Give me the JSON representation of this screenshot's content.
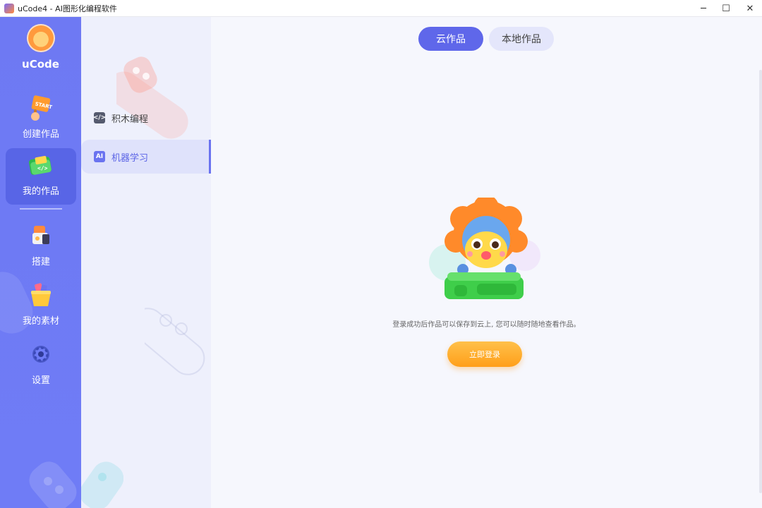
{
  "window": {
    "title": "uCode4 - AI图形化编程软件",
    "minimize_label": "─",
    "maximize_label": "☐",
    "close_label": "✕"
  },
  "nav": {
    "brand": "uCode",
    "items": [
      {
        "label": "创建作品",
        "icon": "start-flag-icon",
        "color": "#ffb23a"
      },
      {
        "label": "我的作品",
        "icon": "folder-code-icon",
        "color": "#4cd163"
      },
      {
        "label": "搭建",
        "icon": "robot-build-icon",
        "color": "#ff7a3a"
      },
      {
        "label": "我的素材",
        "icon": "material-box-icon",
        "color": "#ffcf3a"
      },
      {
        "label": "设置",
        "icon": "gear-icon",
        "color": "#4a58c8"
      }
    ],
    "active_index": 1
  },
  "subnav": {
    "items": [
      {
        "label": "积木编程",
        "icon": "code-block-icon",
        "icon_text": "</>"
      },
      {
        "label": "机器学习",
        "icon": "ai-icon",
        "icon_text": "AI"
      }
    ],
    "active_index": 1
  },
  "main": {
    "tabs": [
      {
        "label": "云作品",
        "active": true
      },
      {
        "label": "本地作品",
        "active": false
      }
    ],
    "message": "登录成功后作品可以保存到云上, 您可以随时随地查看作品。",
    "login_button": "立即登录"
  },
  "colors": {
    "nav_bg": "#6e79f3",
    "accent": "#5f67ea",
    "login_button": "#ffa826"
  }
}
